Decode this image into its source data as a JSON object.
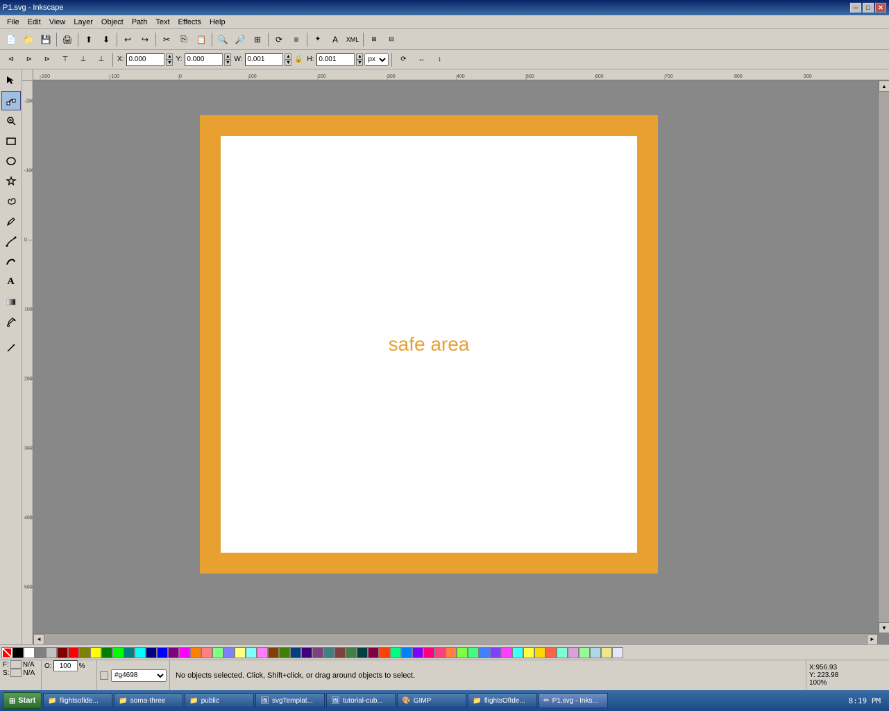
{
  "titlebar": {
    "title": "P1.svg - Inkscape",
    "minimize": "─",
    "maximize": "□",
    "close": "✕"
  },
  "menubar": {
    "items": [
      "File",
      "Edit",
      "View",
      "Layer",
      "Object",
      "Path",
      "Text",
      "Effects",
      "Help"
    ]
  },
  "toolbar2": {
    "x_label": "X:",
    "x_value": "0.000",
    "y_label": "Y:",
    "y_value": "0.000",
    "w_label": "W:",
    "w_value": "0.001",
    "h_label": "H:",
    "h_value": "0.001",
    "unit": "px"
  },
  "canvas": {
    "safe_area_text": "safe area",
    "orange_color": "#e8a030"
  },
  "statusbar": {
    "fill_label": "F:",
    "fill_value": "N/A",
    "stroke_label": "S:",
    "stroke_value": "N/A",
    "opacity_value": "100",
    "layer_id": "#g4698",
    "message": "No objects selected. Click, Shift+click, or drag around objects to select.",
    "x_coord": "X:956.93",
    "y_coord": "Y: 223.98",
    "zoom": "100%"
  },
  "colorpalette": {
    "colors": [
      "#000000",
      "#ffffff",
      "#808080",
      "#c0c0c0",
      "#800000",
      "#ff0000",
      "#808000",
      "#ffff00",
      "#008000",
      "#00ff00",
      "#008080",
      "#00ffff",
      "#000080",
      "#0000ff",
      "#800080",
      "#ff00ff",
      "#ff8000",
      "#ff8080",
      "#80ff80",
      "#8080ff",
      "#ffff80",
      "#80ffff",
      "#ff80ff",
      "#804000",
      "#408000",
      "#004080",
      "#400080",
      "#804080",
      "#408080",
      "#804040",
      "#408040",
      "#004040",
      "#800040",
      "#ff4000",
      "#00ff80",
      "#0080ff",
      "#8000ff",
      "#ff0080",
      "#ff4080",
      "#ff8040",
      "#80ff40",
      "#40ff80",
      "#4080ff",
      "#8040ff",
      "#ff40ff",
      "#40ffff",
      "#ffff40",
      "#ffd700",
      "#ff6347",
      "#7fffd4",
      "#dda0dd",
      "#98fb98",
      "#add8e6",
      "#f0e68c",
      "#e6e6fa"
    ]
  },
  "taskbar": {
    "start_label": "Start",
    "clock_time": "8:19 PM",
    "items": [
      {
        "label": "flightsofide...",
        "active": false
      },
      {
        "label": "soma-three",
        "active": false
      },
      {
        "label": "public",
        "active": false
      },
      {
        "label": "svgTemplat...",
        "active": false
      },
      {
        "label": "tutorial-cub...",
        "active": false
      },
      {
        "label": "GIMP",
        "active": false
      },
      {
        "label": "flightsOfIde...",
        "active": false
      },
      {
        "label": "P1.svg - Inks...",
        "active": true
      }
    ]
  },
  "tools": {
    "items": [
      {
        "name": "selector",
        "icon": "↖",
        "active": false
      },
      {
        "name": "node-editor",
        "icon": "✦",
        "active": true
      },
      {
        "name": "zoom",
        "icon": "🔍",
        "active": false
      },
      {
        "name": "rectangle",
        "icon": "□",
        "active": false
      },
      {
        "name": "ellipse",
        "icon": "○",
        "active": false
      },
      {
        "name": "star",
        "icon": "★",
        "active": false
      },
      {
        "name": "spiral",
        "icon": "🌀",
        "active": false
      },
      {
        "name": "pencil",
        "icon": "✏",
        "active": false
      },
      {
        "name": "pen",
        "icon": "✒",
        "active": false
      },
      {
        "name": "calligraphy",
        "icon": "∫",
        "active": false
      },
      {
        "name": "text",
        "icon": "A",
        "active": false
      },
      {
        "name": "gradient",
        "icon": "◫",
        "active": false
      },
      {
        "name": "dropper",
        "icon": "💧",
        "active": false
      },
      {
        "name": "connector",
        "icon": "↗",
        "active": false
      }
    ]
  }
}
